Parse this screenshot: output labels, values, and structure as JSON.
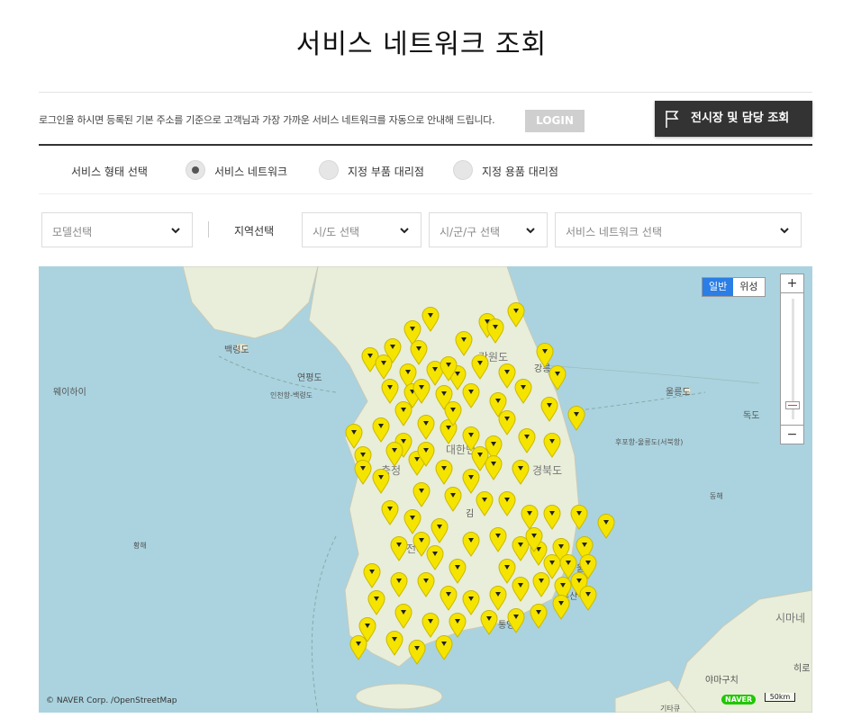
{
  "page": {
    "title": "서비스 네트워크 조회"
  },
  "login": {
    "message": "로그인을 하시면 등록된 기본 주소를 기준으로 고객님과 가장 가까운 서비스 네트워크를 자동으로 안내해 드립니다.",
    "button_label": "LOGIN"
  },
  "dealer_button": {
    "label": "전시장 및 담당 조회",
    "icon": "flag-icon"
  },
  "service_type": {
    "label": "서비스 형태 선택",
    "options": [
      {
        "label": "서비스 네트워크",
        "selected": true
      },
      {
        "label": "지정 부품 대리점",
        "selected": false
      },
      {
        "label": "지정 용품 대리점",
        "selected": false
      }
    ]
  },
  "filters": {
    "model_placeholder": "모델선택",
    "region_label": "지역선택",
    "sido_placeholder": "시/도 선택",
    "sigungu_placeholder": "시/군/구 선택",
    "network_placeholder": "서비스 네트워크 선택"
  },
  "map": {
    "type_buttons": [
      "일반",
      "위성"
    ],
    "active_type": "일반",
    "zoom_in": "+",
    "zoom_out": "−",
    "copyright": "© NAVER Corp. /OpenStreetMap",
    "naver_logo": "NAVER",
    "scale_label": "50km",
    "places": [
      "강원도",
      "경북도",
      "충청",
      "백령도",
      "연평도",
      "웨이하이",
      "울릉도",
      "독도",
      "인천항-백령도",
      "후포항-울릉도(서북항)",
      "동해",
      "황해",
      "울산",
      "부산",
      "시마네",
      "야마구치",
      "히로",
      "기타큐",
      "통영",
      "강릉",
      "대한민",
      "김",
      "전라"
    ],
    "colors": {
      "sea": "#aad3df",
      "land": "#e8eed9",
      "pin": "#f5e400",
      "active": "#2a7ee6"
    }
  }
}
